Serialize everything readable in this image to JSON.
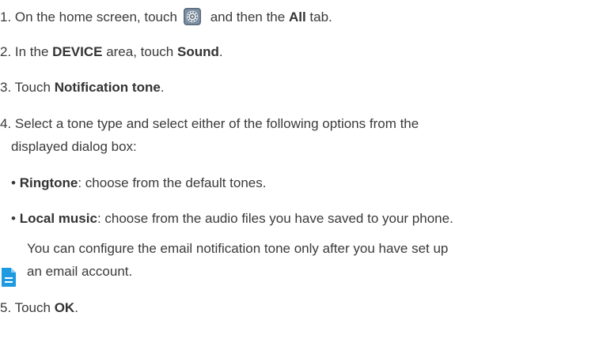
{
  "steps": {
    "step1": {
      "prefix": "1. On the home screen, touch",
      "icon": "settings-gear-icon",
      "middle": " and then the ",
      "bold": "All",
      "suffix": " tab."
    },
    "step2": {
      "prefix": "2. In the ",
      "bold1": "DEVICE",
      "middle": " area, touch ",
      "bold2": "Sound",
      "suffix": "."
    },
    "step3": {
      "prefix": "3. Touch ",
      "bold": "Notification tone",
      "suffix": "."
    },
    "step4": {
      "line1": "4. Select a tone type and select either of the following options from the",
      "line2": "displayed dialog box:"
    },
    "options": [
      {
        "bullet": "• ",
        "bold": "Ringtone",
        "text": ": choose from the default tones."
      },
      {
        "bullet": "• ",
        "bold": "Local music",
        "text": ": choose from the audio files you have saved to your phone."
      }
    ],
    "note": {
      "icon": "note-document-icon",
      "line1": "You can configure the email notification tone only after you have set up",
      "line2": "an email account."
    },
    "step5": {
      "prefix": "5. Touch ",
      "bold": "OK",
      "suffix": "."
    }
  },
  "colors": {
    "text": "#3a3a3a",
    "note_icon": "#1e9be0",
    "settings_icon_bg": "#5a6b7d"
  }
}
